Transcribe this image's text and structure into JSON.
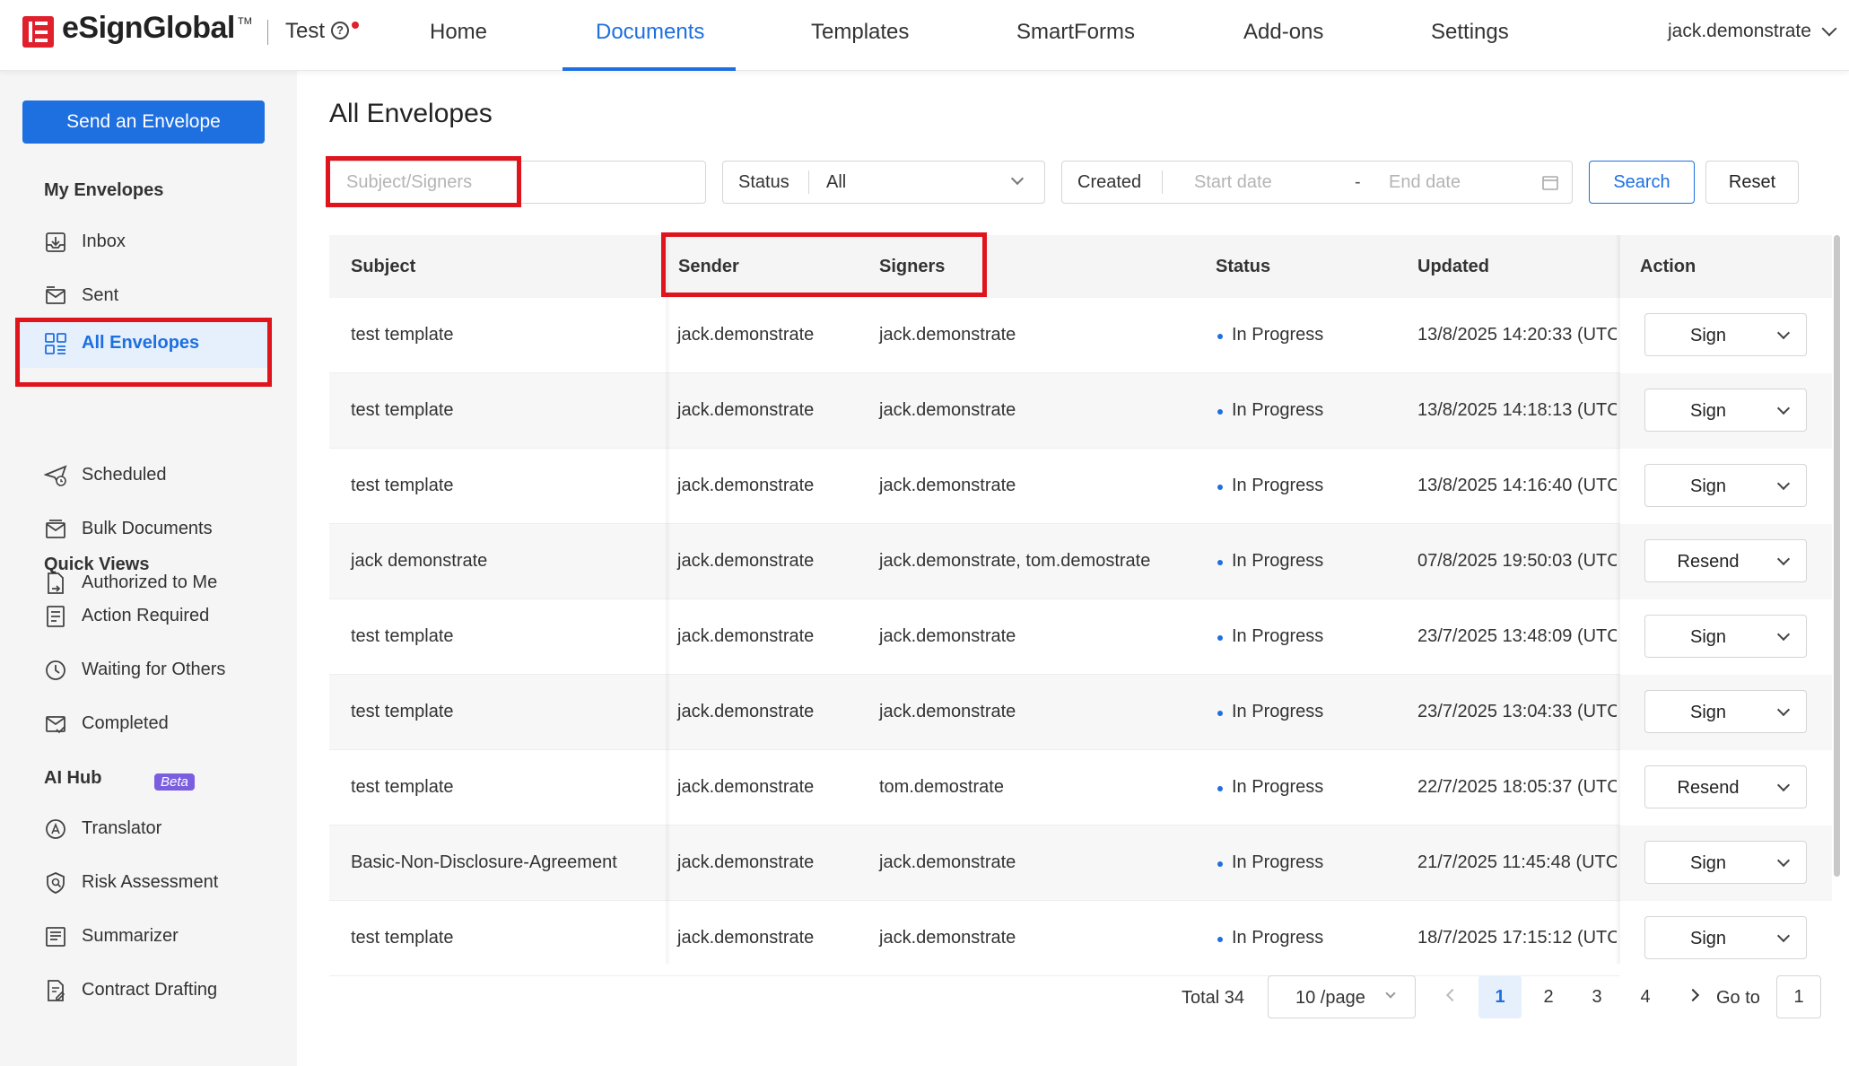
{
  "app": {
    "brand": "eSignGlobal",
    "brand_tm": "TM",
    "org": "Test",
    "help_glyph": "?"
  },
  "nav": {
    "items": [
      "Home",
      "Documents",
      "Templates",
      "SmartForms",
      "Add-ons",
      "Settings"
    ],
    "active": "Documents",
    "user": "jack.demonstrate"
  },
  "sidebar": {
    "send_button": "Send an Envelope",
    "my_envelopes_heading": "My Envelopes",
    "my_envelopes": [
      {
        "label": "Inbox",
        "icon": "inbox-icon"
      },
      {
        "label": "Sent",
        "icon": "sent-icon"
      },
      {
        "label": "All Envelopes",
        "icon": "grid-icon"
      },
      {
        "label": "Scheduled",
        "icon": "scheduled-icon"
      },
      {
        "label": "Bulk Documents",
        "icon": "bulk-icon"
      },
      {
        "label": "Authorized to Me",
        "icon": "authorized-icon"
      }
    ],
    "quick_views_heading": "Quick Views",
    "quick_views": [
      {
        "label": "Action Required",
        "icon": "action-required-icon"
      },
      {
        "label": "Waiting for Others",
        "icon": "clock-icon"
      },
      {
        "label": "Completed",
        "icon": "completed-icon"
      }
    ],
    "ai_hub_heading": "AI Hub",
    "ai_hub_badge": "Beta",
    "ai_hub": [
      {
        "label": "Translator",
        "icon": "translator-icon"
      },
      {
        "label": "Risk Assessment",
        "icon": "risk-icon"
      },
      {
        "label": "Summarizer",
        "icon": "summarizer-icon"
      },
      {
        "label": "Contract Drafting",
        "icon": "drafting-icon"
      }
    ]
  },
  "main": {
    "title": "All Envelopes",
    "filters": {
      "search_placeholder": "Subject/Signers",
      "status_label": "Status",
      "status_value": "All",
      "created_label": "Created",
      "start_placeholder": "Start date",
      "range_sep": "-",
      "end_placeholder": "End date",
      "search_button": "Search",
      "reset_button": "Reset"
    },
    "table": {
      "headers": [
        "Subject",
        "Sender",
        "Signers",
        "Status",
        "Updated",
        "Action"
      ],
      "rows": [
        {
          "subject": "test template",
          "sender": "jack.demonstrate",
          "signers": "jack.demonstrate",
          "status": "In Progress",
          "updated": "13/8/2025 14:20:33 (UTC",
          "action": "Sign"
        },
        {
          "subject": "test template",
          "sender": "jack.demonstrate",
          "signers": "jack.demonstrate",
          "status": "In Progress",
          "updated": "13/8/2025 14:18:13 (UTC",
          "action": "Sign"
        },
        {
          "subject": "test template",
          "sender": "jack.demonstrate",
          "signers": "jack.demonstrate",
          "status": "In Progress",
          "updated": "13/8/2025 14:16:40 (UTC",
          "action": "Sign"
        },
        {
          "subject": "jack demonstrate",
          "sender": "jack.demonstrate",
          "signers": "jack.demonstrate, tom.demostrate",
          "status": "In Progress",
          "updated": "07/8/2025 19:50:03 (UTC",
          "action": "Resend"
        },
        {
          "subject": "test template",
          "sender": "jack.demonstrate",
          "signers": "jack.demonstrate",
          "status": "In Progress",
          "updated": "23/7/2025 13:48:09 (UTC",
          "action": "Sign"
        },
        {
          "subject": "test template",
          "sender": "jack.demonstrate",
          "signers": "jack.demonstrate",
          "status": "In Progress",
          "updated": "23/7/2025 13:04:33 (UTC",
          "action": "Sign"
        },
        {
          "subject": "test template",
          "sender": "jack.demonstrate",
          "signers": "tom.demostrate",
          "status": "In Progress",
          "updated": "22/7/2025 18:05:37 (UTC",
          "action": "Resend"
        },
        {
          "subject": "Basic-Non-Disclosure-Agreement",
          "sender": "jack.demonstrate",
          "signers": "jack.demonstrate",
          "status": "In Progress",
          "updated": "21/7/2025 11:45:48 (UTC",
          "action": "Sign"
        },
        {
          "subject": "test template",
          "sender": "jack.demonstrate",
          "signers": "jack.demonstrate",
          "status": "In Progress",
          "updated": "18/7/2025 17:15:12 (UTC",
          "action": "Sign"
        }
      ]
    },
    "pagination": {
      "total": "Total 34",
      "page_size": "10 /page",
      "pages": [
        "1",
        "2",
        "3",
        "4"
      ],
      "active_page": "1",
      "goto_label": "Go to",
      "goto_value": "1"
    }
  },
  "colors": {
    "accent": "#1e6fe0",
    "brand_red": "#e0202c",
    "highlight_box": "#e0141c",
    "beta_badge": "#7b5ee0"
  }
}
